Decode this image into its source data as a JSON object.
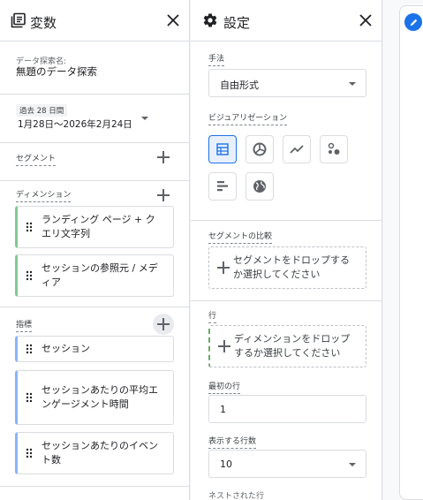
{
  "vars_panel": {
    "title": "変数",
    "exploration_name_label": "データ探索名:",
    "exploration_name": "無題のデータ探索",
    "date_range_label": "過去 28 日間",
    "date_range_value": "1月28日～2026年2月24日",
    "segments_label": "セグメント",
    "dimensions_label": "ディメンション",
    "dimensions": [
      "ランディング ページ + クエリ文字列",
      "セッションの参照元 / メディア"
    ],
    "metrics_label": "指標",
    "metrics": [
      "セッション",
      "セッションあたりの平均エンゲージメント時間",
      "セッションあたりのイベント数"
    ]
  },
  "settings_panel": {
    "title": "設定",
    "technique_label": "手法",
    "technique_value": "自由形式",
    "visualization_label": "ビジュアリゼーション",
    "segment_compare_label": "セグメントの比較",
    "segment_drop_text": "セグメントをドロップするか選択してください",
    "rows_label": "行",
    "rows_drop_text": "ディメンションをドロップするか選択してください",
    "first_row_label": "最初の行",
    "first_row_value": "1",
    "rows_to_show_label": "表示する行数",
    "rows_to_show_value": "10",
    "nested_rows_label": "ネストされた行"
  },
  "icons": {
    "vars": "variables-icon",
    "settings": "gear-icon",
    "close": "close-icon",
    "edit": "pencil-icon"
  },
  "colors": {
    "accent": "#1a73e8",
    "dimension": "#81c995",
    "metric": "#8ab4f8"
  }
}
